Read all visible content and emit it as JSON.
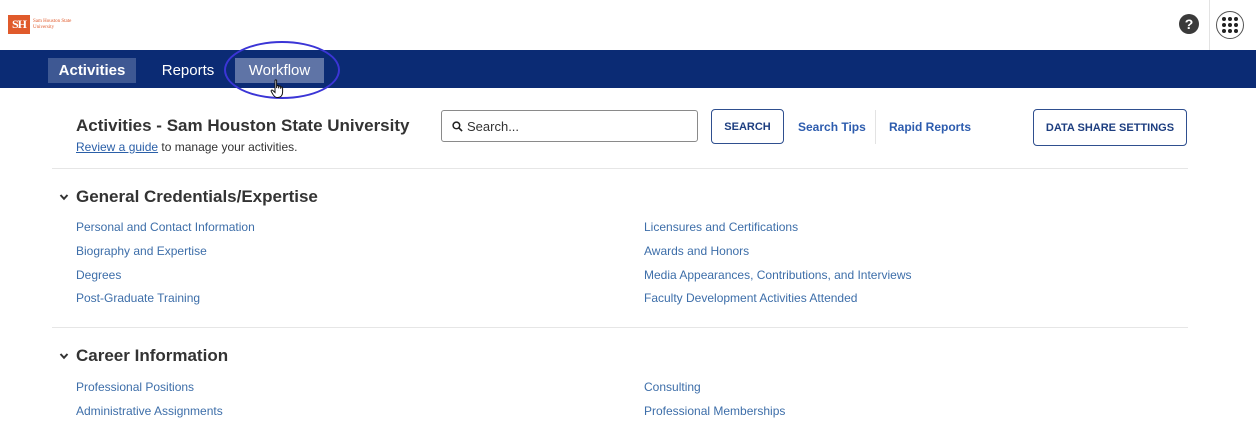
{
  "logo": {
    "mark": "SH",
    "name": "Sam Houston State University"
  },
  "nav": {
    "tabs": [
      "Activities",
      "Reports",
      "Workflow"
    ]
  },
  "header": {
    "title": "Activities - Sam Houston State University",
    "guide_link": "Review a guide",
    "guide_rest": " to manage your activities."
  },
  "search": {
    "placeholder": "Search...",
    "button": "SEARCH"
  },
  "links": {
    "search_tips": "Search Tips",
    "rapid_reports": "Rapid Reports"
  },
  "data_share_button": "DATA SHARE SETTINGS",
  "help_icon_glyph": "?",
  "sections": [
    {
      "title": "General Credentials/Expertise",
      "left": [
        "Personal and Contact Information",
        "Biography and Expertise",
        "Degrees",
        "Post-Graduate Training"
      ],
      "right": [
        "Licensures and Certifications",
        "Awards and Honors",
        "Media Appearances, Contributions, and Interviews",
        "Faculty Development Activities Attended"
      ]
    },
    {
      "title": "Career Information",
      "left": [
        "Professional Positions",
        "Administrative Assignments"
      ],
      "right": [
        "Consulting",
        "Professional Memberships"
      ]
    }
  ],
  "colors": {
    "brand_orange": "#e05a2b",
    "nav_bg": "#0b2b74",
    "link": "#3d6ea9",
    "highlight_ring": "#3b35d6"
  },
  "icons": [
    "help-icon",
    "apps-grid-icon",
    "search-icon",
    "chevron-down-icon",
    "hand-cursor-icon"
  ]
}
